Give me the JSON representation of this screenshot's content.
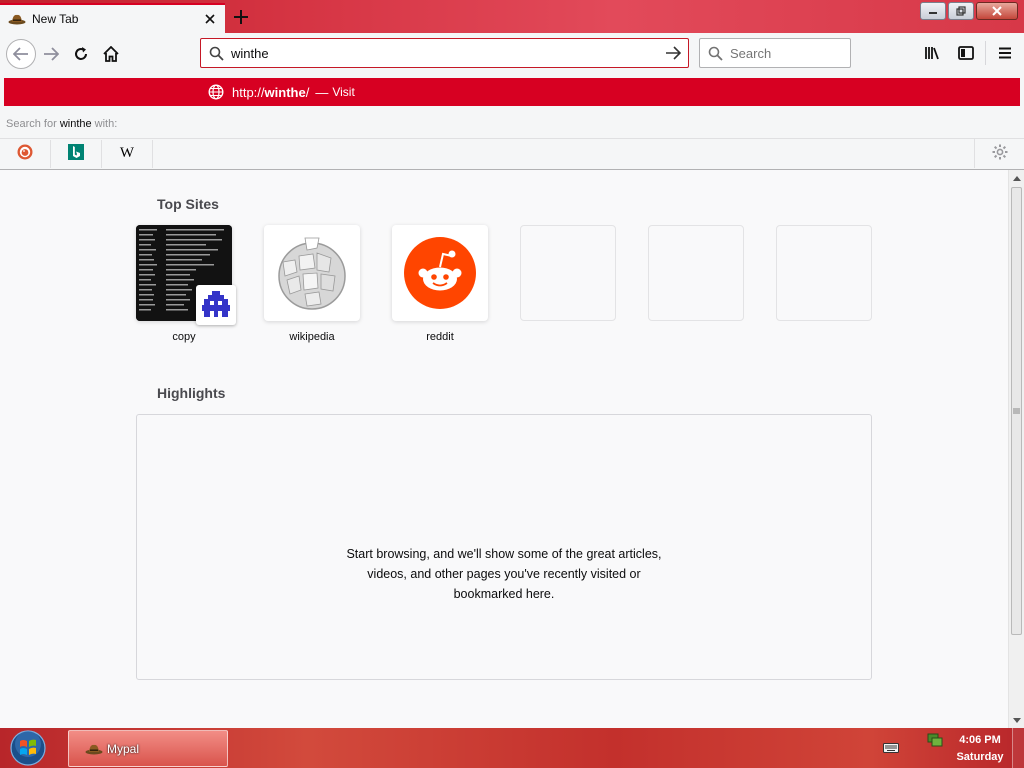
{
  "colors": {
    "accent": "#d70022",
    "taskbar": "#c3302c",
    "content_bg": "#f9f9fa"
  },
  "tab": {
    "title": "New Tab",
    "favicon": "cowboy-hat-icon",
    "close_icon": "close-icon"
  },
  "newtab_symbol": "+",
  "window_controls": {
    "minimize": "minimize-icon",
    "restore": "restore-icon",
    "close": "close-icon"
  },
  "urlbar": {
    "value": "winthe"
  },
  "searchbar": {
    "placeholder": "Search"
  },
  "autocomplete": {
    "url_prefix": "http://",
    "url_host": "winthe",
    "url_suffix": "/",
    "dash": "—",
    "action": "Visit",
    "search_for_prefix": "Search for",
    "search_term": "winthe",
    "search_for_suffix": "with:",
    "engines": [
      {
        "name": "DuckDuckGo",
        "icon": "duckduckgo-icon"
      },
      {
        "name": "Bing",
        "icon": "bing-icon"
      },
      {
        "name": "Wikipedia",
        "icon": "wikipedia-w-icon",
        "glyph": "W"
      }
    ]
  },
  "newtab": {
    "top_sites_title": "Top Sites",
    "top_sites": [
      {
        "label": "copy"
      },
      {
        "label": "wikipedia"
      },
      {
        "label": "reddit"
      },
      {
        "label": ""
      },
      {
        "label": ""
      },
      {
        "label": ""
      }
    ],
    "highlights_title": "Highlights",
    "highlights_empty_line1": "Start browsing, and we'll show some of the great articles,",
    "highlights_empty_line2": "videos, and other pages you've recently visited or",
    "highlights_empty_line3": "bookmarked here."
  },
  "taskbar": {
    "task_label": "Mypal",
    "time": "4:06 PM",
    "day": "Saturday"
  }
}
